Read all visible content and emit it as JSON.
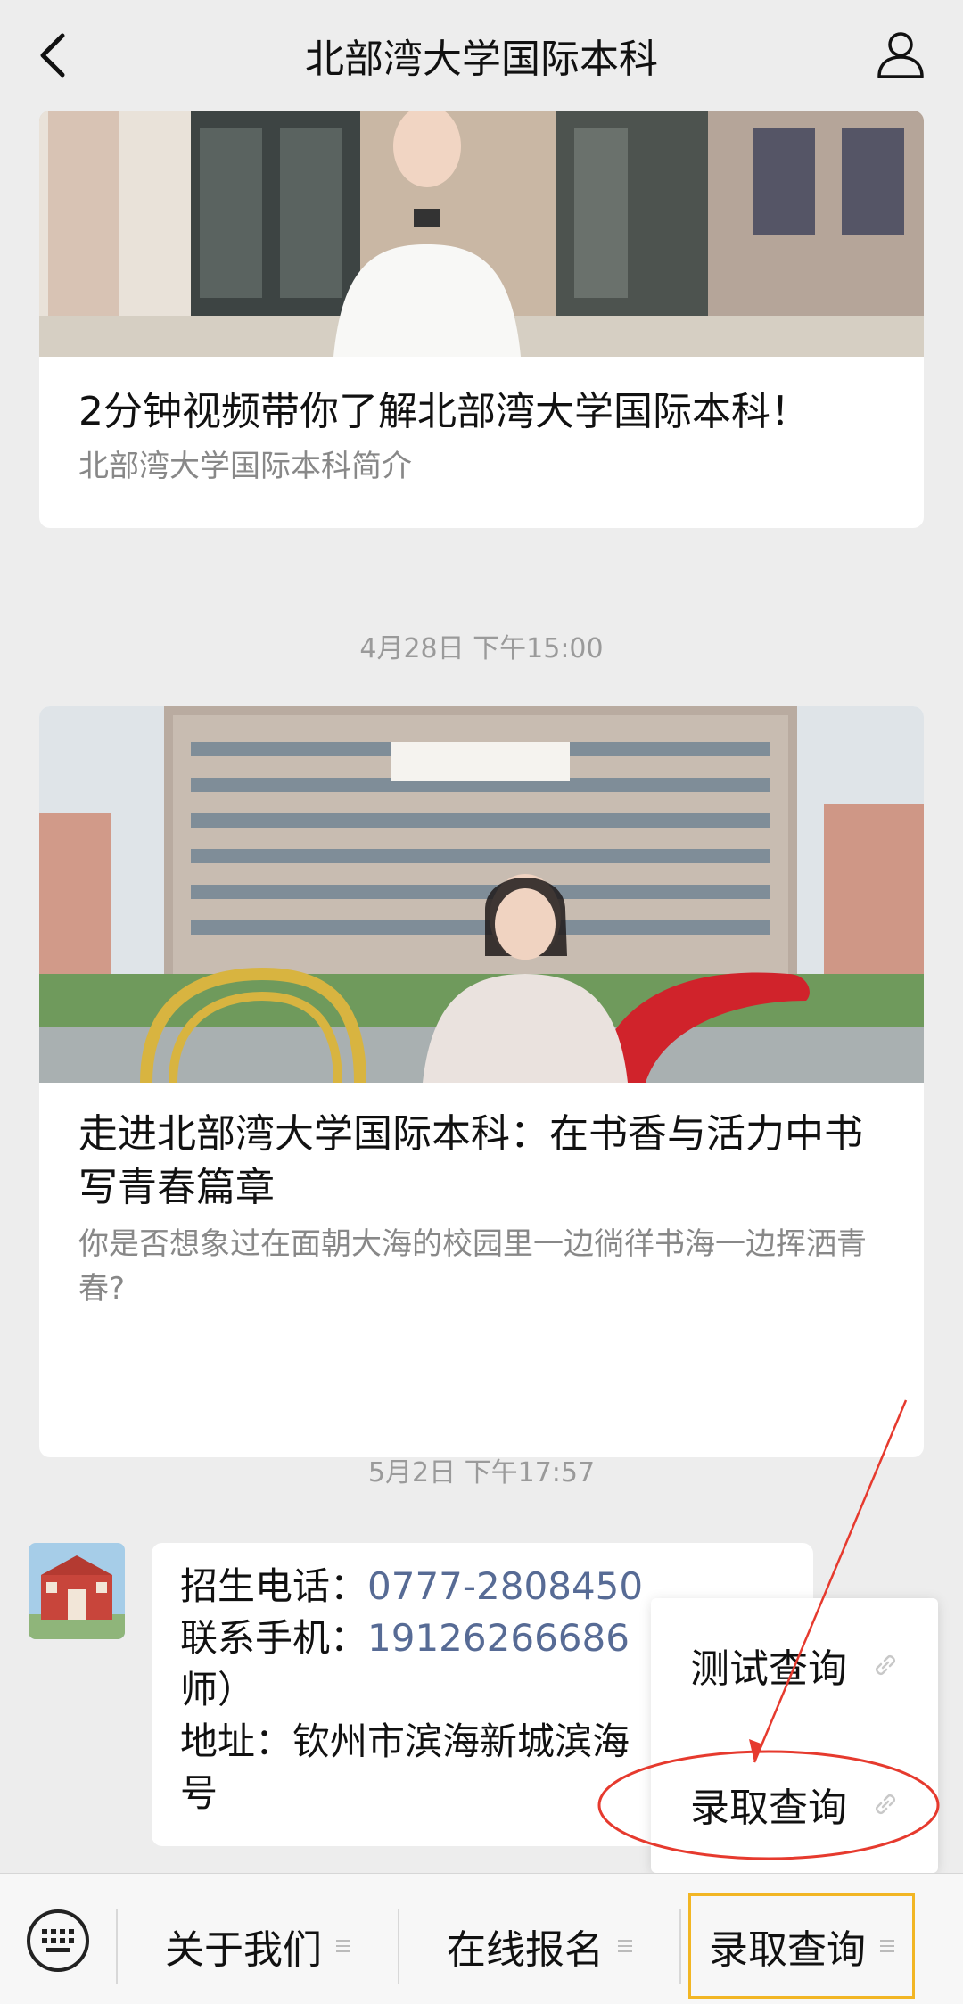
{
  "header": {
    "title": "北部湾大学国际本科"
  },
  "feed": {
    "article1": {
      "title": "2分钟视频带你了解北部湾大学国际本科！",
      "desc": "北部湾大学国际本科简介"
    },
    "time1": "4月28日 下午15:00",
    "article2": {
      "title": "走进北部湾大学国际本科：在书香与活力中书写青春篇章",
      "desc": "你是否想象过在面朝大海的校园里一边徜徉书海一边挥洒青春?"
    },
    "time2": "5月2日 下午17:57",
    "message": {
      "line1_label": "招生电话：",
      "line1_link": "0777-2808450",
      "line2_label": "联系手机：",
      "line2_link": "19126266686",
      "line3": "师）",
      "line4": "地址：钦州市滨海新城滨海",
      "line5": "号"
    }
  },
  "popup": {
    "items": [
      {
        "label": "测试查询"
      },
      {
        "label": "录取查询"
      }
    ]
  },
  "bottom_menu": {
    "items": [
      {
        "label": "关于我们"
      },
      {
        "label": "在线报名"
      },
      {
        "label": "录取查询"
      }
    ],
    "active_index": 2
  },
  "colors": {
    "link": "#576b95",
    "annotation": "#e63a2e",
    "highlight": "#f2b624",
    "background": "#ededed"
  },
  "icons": {
    "back": "chevron-left-icon",
    "profile": "person-icon",
    "keyboard": "keyboard-icon",
    "link": "link-icon",
    "menu": "menu-lines-icon"
  }
}
